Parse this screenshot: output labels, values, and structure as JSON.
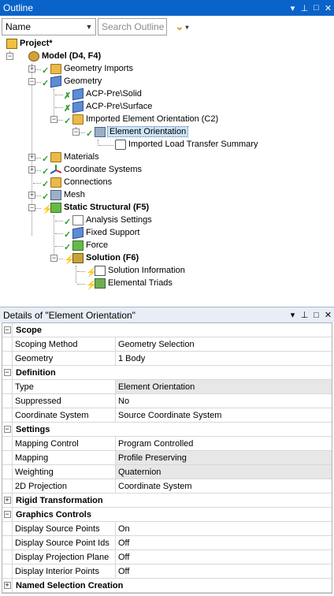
{
  "outline": {
    "title": "Outline",
    "filter_selected": "Name",
    "search_placeholder": "Search Outline"
  },
  "tree": [
    {
      "label": "Project*",
      "bold": true
    },
    {
      "label": "Model (D4, F4)",
      "bold": true
    },
    {
      "label": "Geometry Imports"
    },
    {
      "label": "Geometry"
    },
    {
      "label": "ACP-Pre\\Solid"
    },
    {
      "label": "ACP-Pre\\Surface"
    },
    {
      "label": "Imported Element Orientation (C2)"
    },
    {
      "label": "Element Orientation",
      "selected": true
    },
    {
      "label": "Imported Load Transfer Summary"
    },
    {
      "label": "Materials"
    },
    {
      "label": "Coordinate Systems"
    },
    {
      "label": "Connections"
    },
    {
      "label": "Mesh"
    },
    {
      "label": "Static Structural (F5)",
      "bold": true
    },
    {
      "label": "Analysis Settings"
    },
    {
      "label": "Fixed Support"
    },
    {
      "label": "Force"
    },
    {
      "label": "Solution (F6)",
      "bold": true
    },
    {
      "label": "Solution Information"
    },
    {
      "label": "Elemental Triads"
    }
  ],
  "details": {
    "title": "Details of \"Element Orientation\"",
    "sections": [
      {
        "name": "Scope",
        "expanded": true,
        "rows": [
          {
            "k": "Scoping Method",
            "v": "Geometry Selection"
          },
          {
            "k": "Geometry",
            "v": "1 Body"
          }
        ]
      },
      {
        "name": "Definition",
        "expanded": true,
        "rows": [
          {
            "k": "Type",
            "v": "Element Orientation",
            "gray": true
          },
          {
            "k": "Suppressed",
            "v": "No"
          },
          {
            "k": "Coordinate System",
            "v": "Source Coordinate System"
          }
        ]
      },
      {
        "name": "Settings",
        "expanded": true,
        "rows": [
          {
            "k": "Mapping Control",
            "v": "Program Controlled"
          },
          {
            "k": "Mapping",
            "v": "Profile Preserving",
            "gray": true
          },
          {
            "k": "Weighting",
            "v": "Quaternion",
            "gray": true
          },
          {
            "k": "2D Projection",
            "v": "Coordinate System"
          }
        ]
      },
      {
        "name": "Rigid Transformation",
        "expanded": false,
        "rows": []
      },
      {
        "name": "Graphics Controls",
        "expanded": true,
        "rows": [
          {
            "k": "Display Source Points",
            "v": "On"
          },
          {
            "k": "Display Source Point Ids",
            "v": "Off"
          },
          {
            "k": "Display Projection Plane",
            "v": "Off"
          },
          {
            "k": "Display Interior Points",
            "v": "Off"
          }
        ]
      },
      {
        "name": "Named Selection Creation",
        "expanded": false,
        "rows": []
      }
    ]
  },
  "icons": {
    "pin": "pin-icon",
    "restore": "restore-icon",
    "close": "close-icon",
    "dropdown": "chevron-down-icon"
  }
}
